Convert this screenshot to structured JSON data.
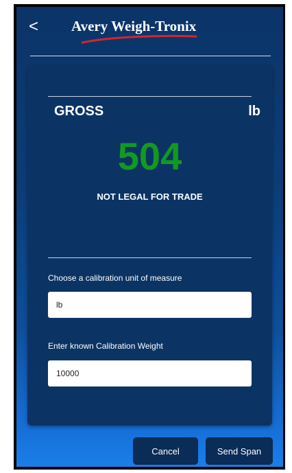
{
  "header": {
    "back_icon": "chevron-left-icon",
    "back_glyph": "<",
    "logo_text": "Avery Weigh-Tronix"
  },
  "display": {
    "mode": "GROSS",
    "unit": "lb",
    "weight": "504",
    "notice": "NOT LEGAL FOR TRADE"
  },
  "form": {
    "unit_label": "Choose a calibration unit of measure",
    "unit_value": "lb",
    "weight_label": "Enter known Calibration Weight",
    "weight_value": "10000"
  },
  "actions": {
    "cancel_label": "Cancel",
    "send_label": "Send Span"
  },
  "colors": {
    "weight_green": "#129a1e",
    "card_bg": "#0b3465",
    "button_bg": "#0a2c57",
    "swoosh_red": "#d8242b"
  }
}
